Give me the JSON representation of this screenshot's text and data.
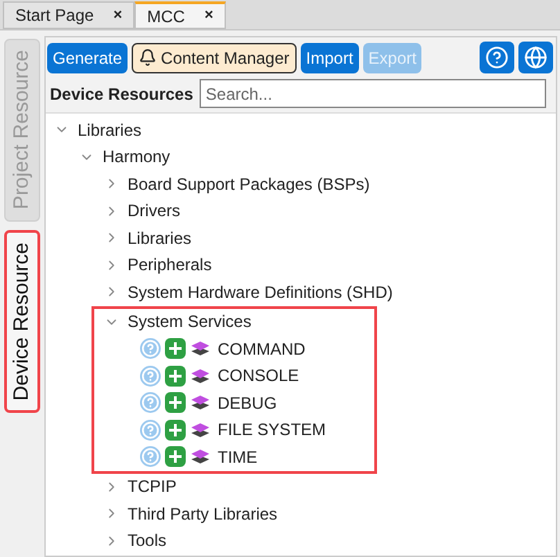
{
  "editor_tabs": [
    {
      "label": "Start Page",
      "selected": false,
      "close": "×"
    },
    {
      "label": "MCC",
      "selected": true,
      "close": "×"
    }
  ],
  "side_tabs": [
    {
      "label": "Project Resource",
      "selected": false,
      "highlighted": false
    },
    {
      "label": "Device Resource",
      "selected": true,
      "highlighted": true
    }
  ],
  "toolbar": {
    "buttons": [
      {
        "label": "Generate",
        "kind": "primary",
        "disabled": false
      },
      {
        "label": "Content Manager",
        "kind": "bell"
      },
      {
        "label": "Import",
        "kind": "primary",
        "disabled": false
      },
      {
        "label": "Export",
        "kind": "primary",
        "disabled": true
      }
    ]
  },
  "search": {
    "label": "Device Resources",
    "placeholder": "Search..."
  },
  "tree": [
    {
      "label": "Libraries",
      "kind": "folder",
      "expanded": true,
      "highlighted": false,
      "children": [
        {
          "label": "Harmony",
          "kind": "folder",
          "expanded": true,
          "highlighted": false,
          "children": [
            {
              "label": "Board Support Packages (BSPs)",
              "kind": "folder",
              "expanded": false,
              "highlighted": false
            },
            {
              "label": "Drivers",
              "kind": "folder",
              "expanded": false,
              "highlighted": false
            },
            {
              "label": "Libraries",
              "kind": "folder",
              "expanded": false,
              "highlighted": false
            },
            {
              "label": "Peripherals",
              "kind": "folder",
              "expanded": false,
              "highlighted": false
            },
            {
              "label": "System Hardware Definitions (SHD)",
              "kind": "folder",
              "expanded": false,
              "highlighted": false
            },
            {
              "label": "System Services",
              "kind": "folder",
              "expanded": true,
              "highlighted": true,
              "children": [
                {
                  "label": "COMMAND",
                  "kind": "component"
                },
                {
                  "label": "CONSOLE",
                  "kind": "component"
                },
                {
                  "label": "DEBUG",
                  "kind": "component"
                },
                {
                  "label": "FILE SYSTEM",
                  "kind": "component"
                },
                {
                  "label": "TIME",
                  "kind": "component"
                }
              ]
            },
            {
              "label": "TCPIP",
              "kind": "folder",
              "expanded": false,
              "highlighted": false
            },
            {
              "label": "Third Party Libraries",
              "kind": "folder",
              "expanded": false,
              "highlighted": false
            },
            {
              "label": "Tools",
              "kind": "folder",
              "expanded": false,
              "highlighted": false
            }
          ]
        }
      ]
    }
  ]
}
